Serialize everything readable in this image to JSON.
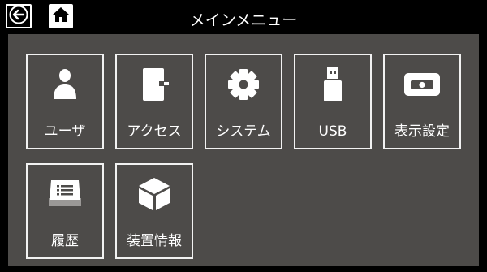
{
  "header": {
    "title": "メインメニュー",
    "back_icon": "arrow-left-icon",
    "home_icon": "home-icon"
  },
  "menu": {
    "items": [
      {
        "label": "ユーザ",
        "icon": "user-icon"
      },
      {
        "label": "アクセス",
        "icon": "door-icon"
      },
      {
        "label": "システム",
        "icon": "gear-icon"
      },
      {
        "label": "USB",
        "icon": "usb-icon"
      },
      {
        "label": "表示設定",
        "icon": "display-icon"
      },
      {
        "label": "履歴",
        "icon": "log-book-icon"
      },
      {
        "label": "装置情報",
        "icon": "device-cube-icon"
      }
    ]
  },
  "colors": {
    "background": "#000000",
    "panel": "#4d4b49",
    "tile_border": "#f2f2f2",
    "text": "#ffffff"
  }
}
